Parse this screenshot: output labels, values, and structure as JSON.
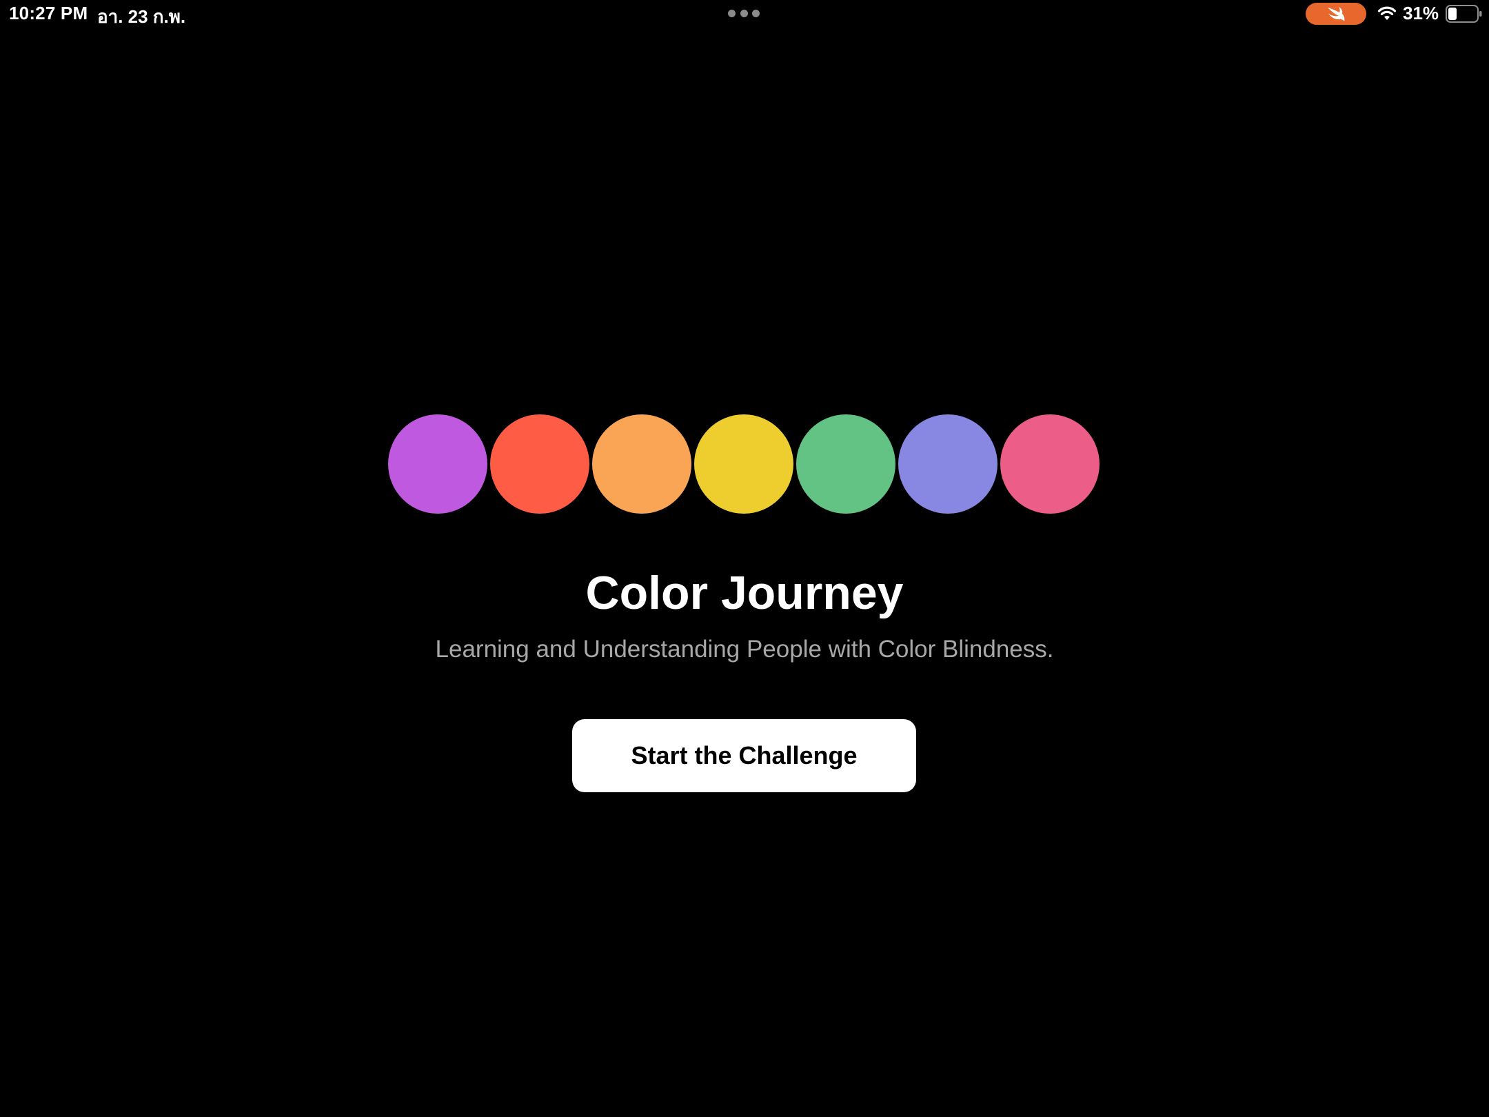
{
  "status_bar": {
    "time": "10:27 PM",
    "date": "อา. 23 ก.พ.",
    "battery_percent": "31%",
    "battery_level": 0.31,
    "icons": [
      "multitasking-dots-icon",
      "swift-playgrounds-icon",
      "wifi-icon",
      "battery-icon"
    ],
    "swift_pill_color": "#E8672C"
  },
  "main": {
    "color_dots": [
      {
        "name": "purple",
        "color": "#BF5AE0"
      },
      {
        "name": "red",
        "color": "#FF5C45"
      },
      {
        "name": "orange",
        "color": "#FAA555"
      },
      {
        "name": "yellow",
        "color": "#EECD2F"
      },
      {
        "name": "green",
        "color": "#63C385"
      },
      {
        "name": "indigo",
        "color": "#8887E2"
      },
      {
        "name": "pink",
        "color": "#EC5D87"
      }
    ],
    "title": "Color Journey",
    "subtitle": "Learning and Understanding People with Color Blindness.",
    "subtitle_color": "#A8A8A8",
    "start_button_label": "Start the Challenge"
  }
}
